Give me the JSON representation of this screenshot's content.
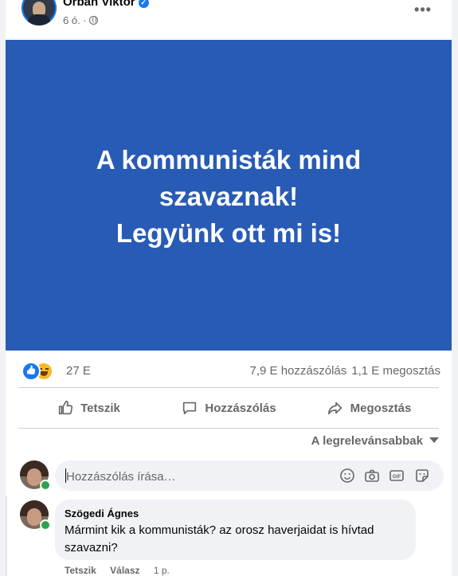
{
  "post": {
    "author": "Orbán Viktor",
    "time": "6 ó. ·",
    "banner_lines": [
      "A kommunisták mind",
      "szavaznak!",
      "Legyünk ott mi is!"
    ],
    "banner_color": "#285bb5",
    "reactions_count": "27 E",
    "comments_count": "7,9 E hozzászólás",
    "shares_count": "1,1 E megosztás"
  },
  "actions": {
    "like": "Tetszik",
    "comment": "Hozzászólás",
    "share": "Megosztás"
  },
  "sort": {
    "label": "A legrelevánsabbak"
  },
  "composer": {
    "placeholder": "Hozzászólás írása…"
  },
  "comment": {
    "author": "Szögedi Ágnes",
    "text": "Mármint kik a kommunisták? az orosz haverjaidat is hívtad szavazni?",
    "like": "Tetszik",
    "reply": "Válasz",
    "time": "1 p."
  },
  "icons": {
    "verified": "verified-badge-icon",
    "globe": "globe-icon",
    "more": "more-options-icon",
    "like_reaction": "like-reaction-icon",
    "haha_reaction": "haha-reaction-icon",
    "thumbs_up": "thumbs-up-icon",
    "comment": "comment-icon",
    "share": "share-icon",
    "emoji": "emoji-icon",
    "camera": "camera-icon",
    "gif": "gif-icon",
    "sticker": "sticker-icon"
  },
  "colors": {
    "accent": "#1877f2",
    "online": "#31a24c"
  }
}
